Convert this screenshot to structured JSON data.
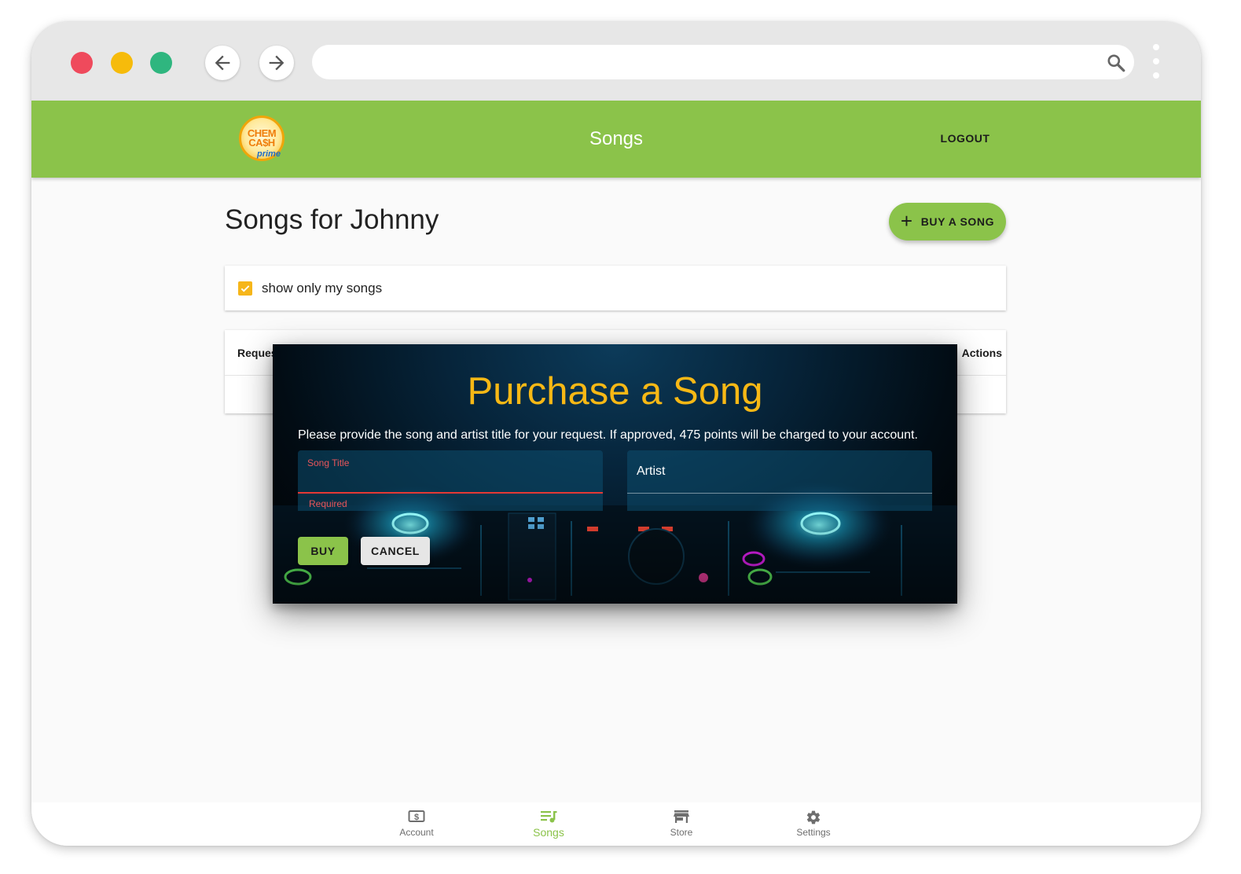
{
  "browser": {
    "traffic_lights": {
      "red": "#ef4a5c",
      "yellow": "#f6bb0b",
      "green": "#2fb67f"
    },
    "url": ""
  },
  "appbar": {
    "logo": {
      "line1": "CHEM",
      "line2": "CA$H",
      "line3": "prime"
    },
    "title": "Songs",
    "logout_label": "LOGOUT",
    "color": "#8bc34a"
  },
  "page": {
    "title": "Songs for Johnny",
    "buy_button_label": "BUY A SONG",
    "filter": {
      "label": "show only my songs",
      "checked": true
    },
    "table": {
      "col_left": "Reques",
      "col_right": "Actions"
    }
  },
  "dialog": {
    "title": "Purchase a Song",
    "message": "Please provide the song and artist title for your request. If approved, 475 points will be charged to your account.",
    "song_field": {
      "label": "Song Title",
      "value": "",
      "helper": "Required"
    },
    "artist_field": {
      "placeholder": "Artist",
      "value": ""
    },
    "buy_label": "BUY",
    "cancel_label": "CANCEL",
    "title_color": "#f7b815"
  },
  "bottom_nav": {
    "items": [
      {
        "label": "Account",
        "icon": "account-dollar-icon"
      },
      {
        "label": "Songs",
        "icon": "music-queue-icon",
        "active": true
      },
      {
        "label": "Store",
        "icon": "store-icon"
      },
      {
        "label": "Settings",
        "icon": "gear-icon"
      }
    ]
  }
}
